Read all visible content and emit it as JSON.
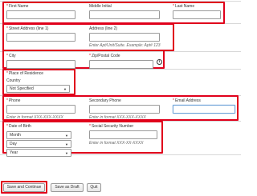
{
  "name": {
    "first_label": "First Name",
    "middle_label": "Middle Initial",
    "last_label": "Last Name"
  },
  "address": {
    "street1_label": "Street Address (line 1)",
    "street2_label": "Address (line 2)",
    "street2_hint": "Enter Apt/Unit/Suite. Example: Apt# 123"
  },
  "city": {
    "city_label": "City",
    "zip_label": "Zip/Postal Code",
    "info_icon": "i"
  },
  "residence": {
    "title": "Place of Residence",
    "country_label": "Country",
    "country_value": "Not Specified"
  },
  "contact": {
    "phone_label": "Phone",
    "phone_hint": "Enter in format XXX-XXX-XXXX",
    "secondary_label": "Secondary Phone",
    "secondary_hint": "Enter in format XXX-XXX-XXXX",
    "email_label": "Email Address"
  },
  "dob": {
    "label": "Date of Birth",
    "month": "Month",
    "day": "Day",
    "year": "Year"
  },
  "ssn": {
    "label": "Social Security Number",
    "hint": "Enter in format XXX-XX-XXXX"
  },
  "actions": {
    "save_continue": "Save and Continue",
    "save_draft": "Save as Draft",
    "quit": "Quit"
  },
  "icons": {
    "required_marker": "*",
    "dropdown_caret": "▼"
  },
  "colors": {
    "highlight": "#e0001b",
    "required": "#e0001b",
    "focus": "#6fa3d8"
  }
}
